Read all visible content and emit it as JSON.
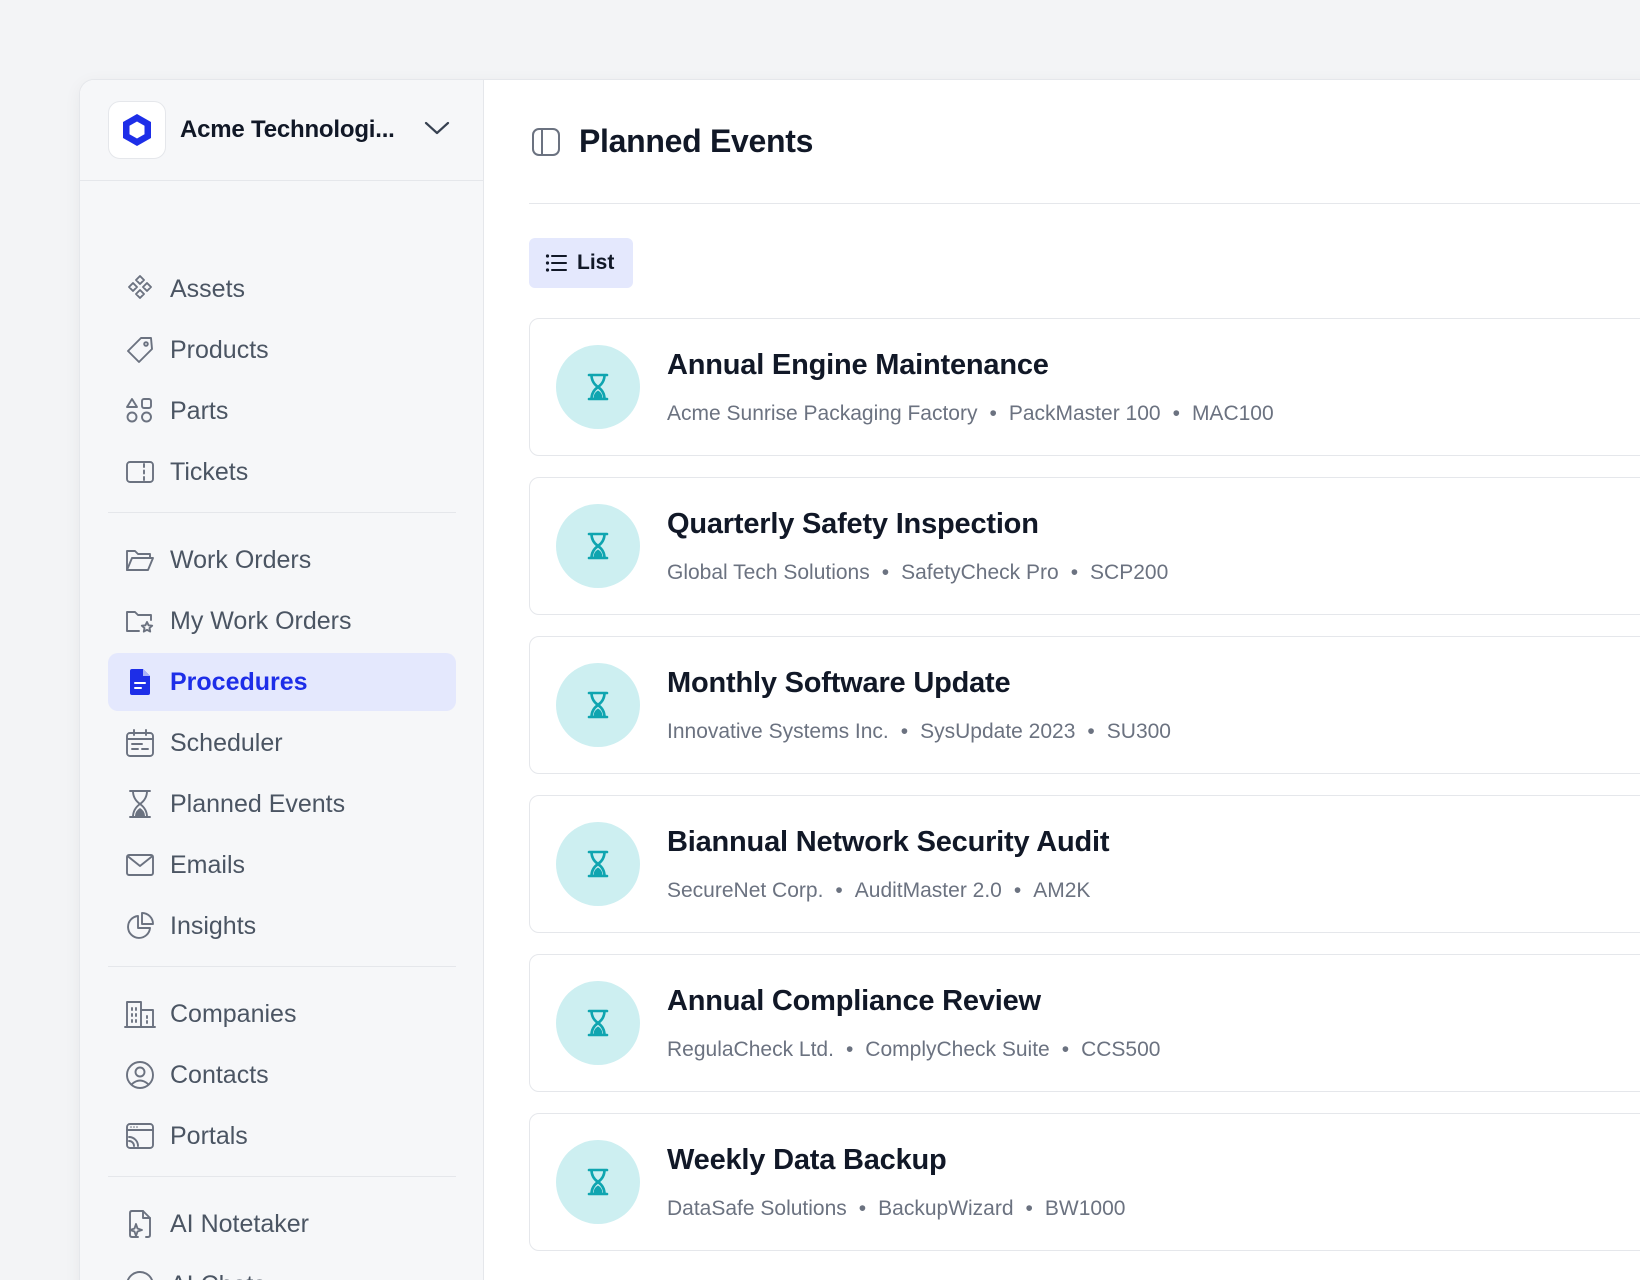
{
  "org": {
    "name": "Acme Technologi..."
  },
  "sidebar": {
    "groups": [
      [
        {
          "label": "Assets",
          "icon": "diamond-grid-icon"
        },
        {
          "label": "Products",
          "icon": "tag-icon"
        },
        {
          "label": "Parts",
          "icon": "shapes-icon"
        },
        {
          "label": "Tickets",
          "icon": "ticket-icon"
        }
      ],
      [
        {
          "label": "Work Orders",
          "icon": "folder-open-icon"
        },
        {
          "label": "My Work Orders",
          "icon": "folder-star-icon"
        },
        {
          "label": "Procedures",
          "icon": "document-icon",
          "active": true
        },
        {
          "label": "Scheduler",
          "icon": "calendar-icon"
        },
        {
          "label": "Planned Events",
          "icon": "hourglass-icon"
        },
        {
          "label": "Emails",
          "icon": "mail-icon"
        },
        {
          "label": "Insights",
          "icon": "pie-chart-icon"
        }
      ],
      [
        {
          "label": "Companies",
          "icon": "building-icon"
        },
        {
          "label": "Contacts",
          "icon": "user-circle-icon"
        },
        {
          "label": "Portals",
          "icon": "browser-window-icon"
        }
      ],
      [
        {
          "label": "AI Notetaker",
          "icon": "file-sparkle-icon"
        },
        {
          "label": "AI Chats",
          "icon": "ai-chat-icon"
        }
      ]
    ]
  },
  "page": {
    "title": "Planned Events",
    "view_label": "List"
  },
  "events": [
    {
      "title": "Annual Engine Maintenance",
      "company": "Acme Sunrise Packaging Factory",
      "product": "PackMaster 100",
      "code": "MAC100"
    },
    {
      "title": "Quarterly Safety Inspection",
      "company": "Global Tech Solutions",
      "product": "SafetyCheck Pro",
      "code": "SCP200"
    },
    {
      "title": "Monthly Software Update",
      "company": "Innovative Systems Inc.",
      "product": "SysUpdate 2023",
      "code": "SU300"
    },
    {
      "title": "Biannual Network Security Audit",
      "company": "SecureNet Corp.",
      "product": "AuditMaster 2.0",
      "code": "AM2K"
    },
    {
      "title": "Annual Compliance Review",
      "company": "RegulaCheck Ltd.",
      "product": "ComplyCheck Suite",
      "code": "CCS500"
    },
    {
      "title": "Weekly Data Backup",
      "company": "DataSafe Solutions",
      "product": "BackupWizard",
      "code": "BW1000"
    }
  ],
  "colors": {
    "accent": "#1d2ee8",
    "event_icon": "#0fa5b0",
    "event_icon_bg": "#cdeff1"
  }
}
